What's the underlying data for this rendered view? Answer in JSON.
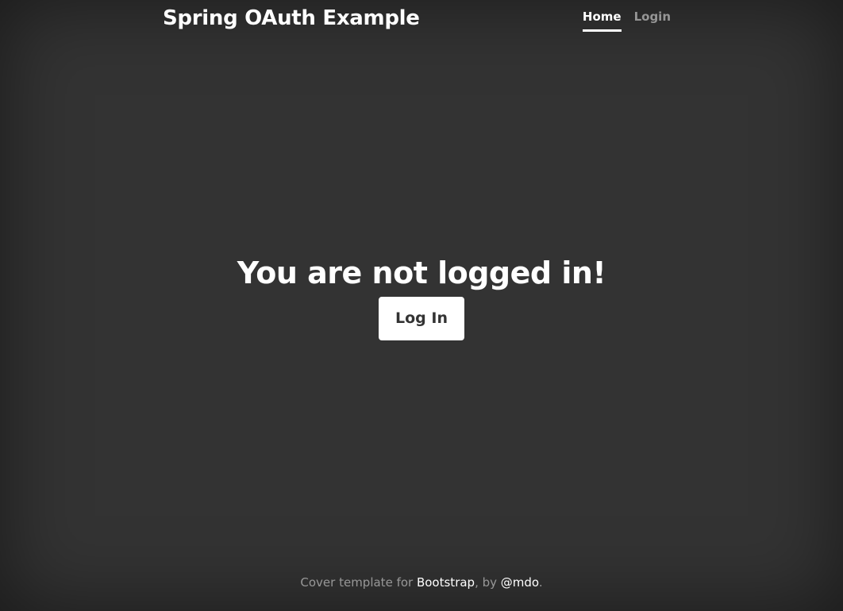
{
  "header": {
    "brand": "Spring OAuth Example",
    "nav": [
      {
        "label": "Home",
        "active": true
      },
      {
        "label": "Login",
        "active": false
      }
    ]
  },
  "main": {
    "heading": "You are not logged in!",
    "login_button": "Log In"
  },
  "footer": {
    "prefix": "Cover template for ",
    "bootstrap_link": "Bootstrap",
    "middle": ", by ",
    "author_link": "@mdo",
    "suffix": "."
  },
  "colors": {
    "background": "#333333",
    "text": "#ffffff",
    "muted_text": "rgba(255,255,255,.5)",
    "button_text": "#333333"
  }
}
